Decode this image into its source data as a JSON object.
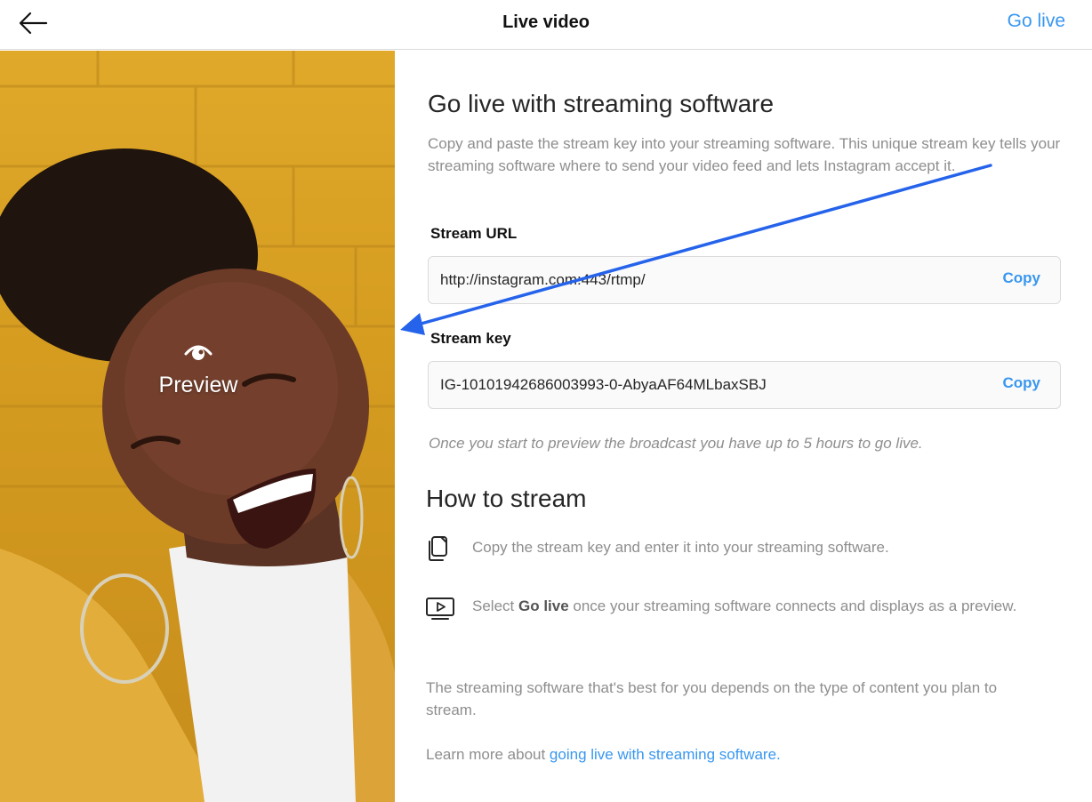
{
  "header": {
    "title": "Live video",
    "go_live_label": "Go live",
    "back_icon": "arrow-left-icon"
  },
  "preview": {
    "label": "Preview",
    "icon": "eye-icon"
  },
  "main": {
    "heading": "Go live with streaming software",
    "description": "Copy and paste the stream key into your streaming software. This unique stream key tells your streaming software where to send your video feed and lets Instagram accept it.",
    "stream_url": {
      "label": "Stream URL",
      "value": "http://instagram.com:443/rtmp/",
      "copy_label": "Copy"
    },
    "stream_key": {
      "label": "Stream key",
      "value": "IG-10101942686003993-0-AbyaAF64MLbaxSBJ",
      "copy_label": "Copy"
    },
    "hint": "Once you start to preview the broadcast you have up to 5 hours to go live.",
    "how_to": {
      "heading": "How to stream",
      "steps": [
        {
          "icon": "copy-icon",
          "text": "Copy the stream key and enter it into your streaming software."
        },
        {
          "icon": "play-screen-icon",
          "text_before": "Select ",
          "text_bold": "Go live",
          "text_after": " once your streaming software connects and displays as a preview."
        }
      ]
    },
    "note": "The streaming software that's best for you depends on the type of content you plan to stream.",
    "learn_more": {
      "prefix": "Learn more about ",
      "link_text": "going live with streaming software."
    }
  },
  "colors": {
    "accent": "#3897f0",
    "annotation_arrow": "#2563eb",
    "preview_bg": "#d9a024"
  }
}
